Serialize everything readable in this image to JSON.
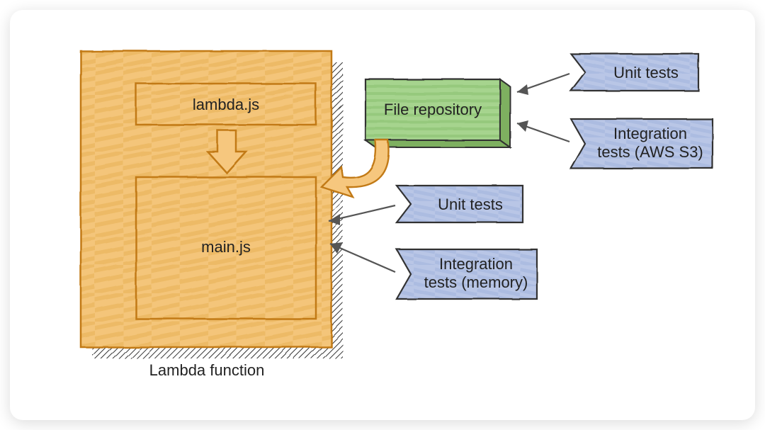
{
  "lambda_container_label": "Lambda function",
  "lambda_js_label": "lambda.js",
  "main_js_label": "main.js",
  "file_repo_label": "File repository",
  "tag_unit_tests_top": "Unit tests",
  "tag_integration_s3_line1": "Integration",
  "tag_integration_s3_line2": "tests (AWS S3)",
  "tag_unit_tests_mid": "Unit tests",
  "tag_integration_mem_line1": "Integration",
  "tag_integration_mem_line2": "tests (memory)",
  "colors": {
    "orange_fill": "#f4c57a",
    "orange_stroke": "#c27a17",
    "green_fill": "#a6d48e",
    "green_stroke": "#333",
    "blue_fill": "#b9c6e6",
    "blue_stroke": "#333"
  }
}
